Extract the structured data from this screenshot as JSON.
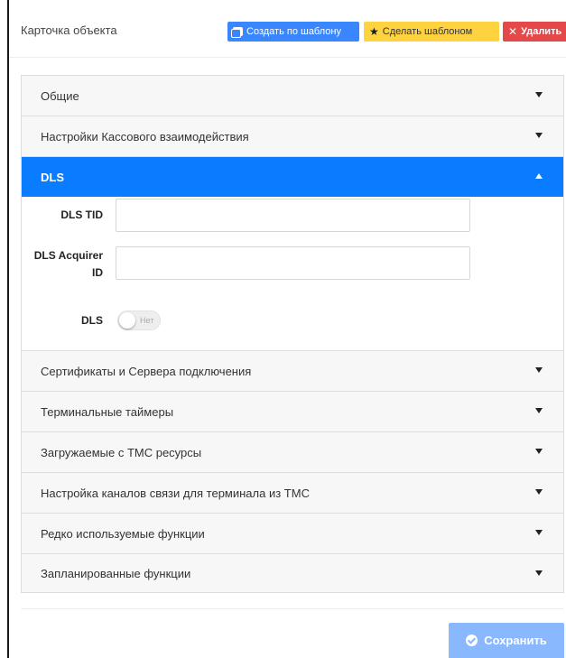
{
  "header": {
    "title": "Карточка объекта",
    "btn_create_label": "Создать по шаблону",
    "btn_template_label": "Сделать шаблоном",
    "btn_delete_label": "Удалить"
  },
  "accordion": {
    "sections_top": [
      {
        "label": "Общие"
      },
      {
        "label": "Настройки Кассового взаимодействия"
      }
    ],
    "active_section": {
      "label": "DLS",
      "expanded": true
    },
    "sections_bottom": [
      {
        "label": "Сертификаты и Сервера подключения"
      },
      {
        "label": "Терминальные таймеры"
      },
      {
        "label": "Загружаемые с ТМС ресурсы"
      },
      {
        "label": "Настройка каналов связи для терминала из ТМС"
      },
      {
        "label": "Редко используемые функции"
      },
      {
        "label": "Запланированные функции"
      }
    ]
  },
  "dls_form": {
    "tid_label": "DLS TID",
    "tid_value": "",
    "acquirer_label_line1": "DLS Acquirer",
    "acquirer_label_line2": "ID",
    "acquirer_value": "",
    "toggle_label": "DLS",
    "toggle_state_text": "Нет",
    "toggle_on": false
  },
  "footer": {
    "save_label": "Сохранить"
  },
  "colors": {
    "primary": "#0a7cff",
    "create_button": "#3a86ff",
    "template_button": "#ffd23f",
    "delete_button": "#e54848",
    "save_button_disabled": "#8ab8ff"
  }
}
